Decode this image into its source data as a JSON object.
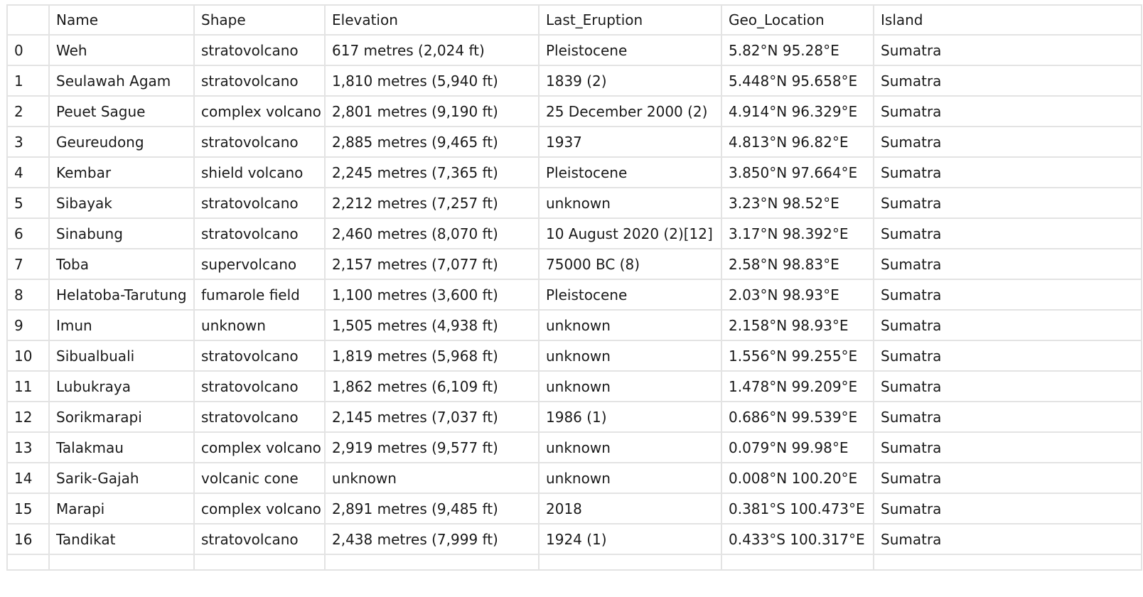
{
  "table": {
    "columns": [
      "",
      "Name",
      "Shape",
      "Elevation",
      "Last_Eruption",
      "Geo_Location",
      "Island"
    ],
    "rows": [
      [
        "0",
        "Weh",
        "stratovolcano",
        "617 metres (2,024 ft)",
        "Pleistocene",
        "5.82°N 95.28°E",
        "Sumatra"
      ],
      [
        "1",
        "Seulawah Agam",
        "stratovolcano",
        "1,810 metres (5,940 ft)",
        "1839 (2)",
        "5.448°N 95.658°E",
        "Sumatra"
      ],
      [
        "2",
        "Peuet Sague",
        "complex volcano",
        "2,801 metres (9,190 ft)",
        "25 December 2000 (2)",
        "4.914°N 96.329°E",
        "Sumatra"
      ],
      [
        "3",
        "Geureudong",
        "stratovolcano",
        "2,885 metres (9,465 ft)",
        "1937",
        "4.813°N 96.82°E",
        "Sumatra"
      ],
      [
        "4",
        "Kembar",
        "shield volcano",
        "2,245 metres (7,365 ft)",
        "Pleistocene",
        "3.850°N 97.664°E",
        "Sumatra"
      ],
      [
        "5",
        "Sibayak",
        "stratovolcano",
        "2,212 metres (7,257 ft)",
        "unknown",
        "3.23°N 98.52°E",
        "Sumatra"
      ],
      [
        "6",
        "Sinabung",
        "stratovolcano",
        "2,460 metres (8,070 ft)",
        "10 August 2020 (2)[12]",
        "3.17°N 98.392°E",
        "Sumatra"
      ],
      [
        "7",
        "Toba",
        "supervolcano",
        "2,157 metres (7,077 ft)",
        "75000 BC (8)",
        "2.58°N 98.83°E",
        "Sumatra"
      ],
      [
        "8",
        "Helatoba-Tarutung",
        "fumarole field",
        "1,100 metres (3,600 ft)",
        "Pleistocene",
        "2.03°N 98.93°E",
        "Sumatra"
      ],
      [
        "9",
        "Imun",
        "unknown",
        "1,505 metres (4,938 ft)",
        "unknown",
        "2.158°N 98.93°E",
        "Sumatra"
      ],
      [
        "10",
        "Sibualbuali",
        "stratovolcano",
        "1,819 metres (5,968 ft)",
        "unknown",
        "1.556°N 99.255°E",
        "Sumatra"
      ],
      [
        "11",
        "Lubukraya",
        "stratovolcano",
        "1,862 metres (6,109 ft)",
        "unknown",
        "1.478°N 99.209°E",
        "Sumatra"
      ],
      [
        "12",
        "Sorikmarapi",
        "stratovolcano",
        "2,145 metres (7,037 ft)",
        "1986 (1)",
        "0.686°N 99.539°E",
        "Sumatra"
      ],
      [
        "13",
        "Talakmau",
        "complex volcano",
        "2,919 metres (9,577 ft)",
        "unknown",
        "0.079°N 99.98°E",
        "Sumatra"
      ],
      [
        "14",
        "Sarik-Gajah",
        "volcanic cone",
        "unknown",
        "unknown",
        "0.008°N 100.20°E",
        "Sumatra"
      ],
      [
        "15",
        "Marapi",
        "complex volcano",
        "2,891 metres (9,485 ft)",
        "2018",
        "0.381°S 100.473°E",
        "Sumatra"
      ],
      [
        "16",
        "Tandikat",
        "stratovolcano",
        "2,438 metres (7,999 ft)",
        "1924 (1)",
        "0.433°S 100.317°E",
        "Sumatra"
      ]
    ]
  }
}
